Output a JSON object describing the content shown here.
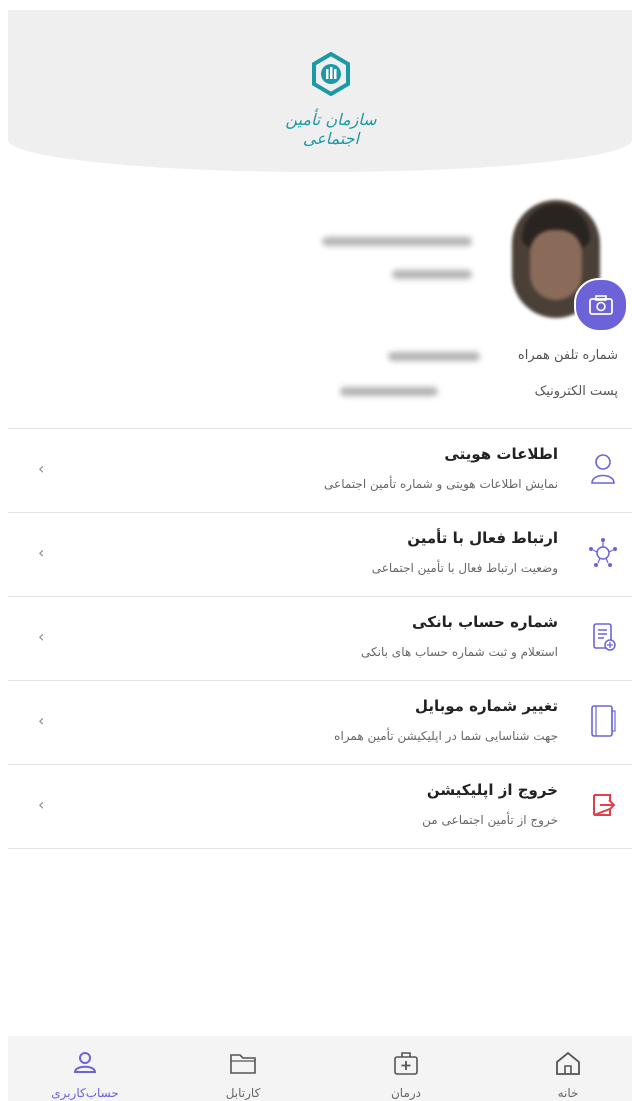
{
  "header": {
    "logo_text": "سازمان تأمین اجتماعی",
    "logo_icon": "tamin-logo-icon"
  },
  "profile": {
    "avatar_icon": "user-photo",
    "camera_icon": "camera-icon",
    "phone_label": "شماره تلفن همراه",
    "email_label": "پست الکترونیک"
  },
  "menu": {
    "items": [
      {
        "title": "اطلاعات هویتی",
        "desc": "نمایش اطلاعات هویتی و شماره تأمین اجتماعی",
        "icon": "user-icon"
      },
      {
        "title": "ارتباط فعال با تأمین",
        "desc": "وضعیت ارتباط فعال با تأمین اجتماعی",
        "icon": "network-icon"
      },
      {
        "title": "شماره حساب بانکی",
        "desc": "استعلام و ثبت شماره حساب های بانکی",
        "icon": "bank-document-icon"
      },
      {
        "title": "تغییر شماره موبایل",
        "desc": "جهت شناسایی شما در اپلیکیشن تأمین همراه",
        "icon": "mobile-icon"
      },
      {
        "title": "خروج از اپلیکیشن",
        "desc": "خروج از تأمین اجتماعی من",
        "icon": "logout-icon"
      }
    ]
  },
  "bottom_nav": {
    "items": [
      {
        "label": "حساب‌کاربری",
        "icon": "user-account-icon",
        "active": true
      },
      {
        "label": "کارتابل",
        "icon": "folder-icon",
        "active": false
      },
      {
        "label": "درمان",
        "icon": "medical-kit-icon",
        "active": false
      },
      {
        "label": "خانه",
        "icon": "home-icon",
        "active": false
      }
    ]
  },
  "colors": {
    "accent": "#6c63d8",
    "logo_teal": "#1a9aa6",
    "logout_red": "#e0404a"
  }
}
